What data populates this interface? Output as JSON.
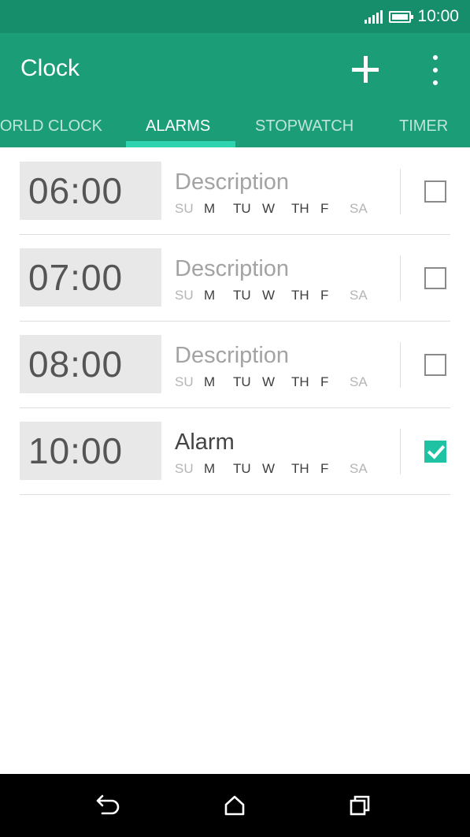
{
  "status_bar": {
    "time": "10:00"
  },
  "app_bar": {
    "title": "Clock",
    "add_icon": "plus-icon",
    "menu_icon": "overflow-menu-icon"
  },
  "tabs": [
    {
      "label": "WORLD CLOCK",
      "active": false
    },
    {
      "label": "ALARMS",
      "active": true
    },
    {
      "label": "STOPWATCH",
      "active": false
    },
    {
      "label": "TIMER",
      "active": false
    }
  ],
  "days_labels": [
    "SU",
    "M",
    "TU",
    "W",
    "TH",
    "F",
    "SA"
  ],
  "alarms": [
    {
      "time": "06:00",
      "description": "Description",
      "enabled": false,
      "days_active": [
        false,
        true,
        true,
        true,
        true,
        true,
        false
      ]
    },
    {
      "time": "07:00",
      "description": "Description",
      "enabled": false,
      "days_active": [
        false,
        true,
        true,
        true,
        true,
        true,
        false
      ]
    },
    {
      "time": "08:00",
      "description": "Description",
      "enabled": false,
      "days_active": [
        false,
        true,
        true,
        true,
        true,
        true,
        false
      ]
    },
    {
      "time": "10:00",
      "description": "Alarm",
      "enabled": true,
      "days_active": [
        false,
        true,
        true,
        true,
        true,
        true,
        false
      ]
    }
  ],
  "colors": {
    "status_bar": "#178e6b",
    "app_bar": "#1b9e78",
    "tab_indicator": "#2ed4b0",
    "checkbox_checked": "#1fc3a4"
  },
  "nav_bar": {
    "icons": [
      "back-icon",
      "home-icon",
      "recents-icon"
    ]
  }
}
